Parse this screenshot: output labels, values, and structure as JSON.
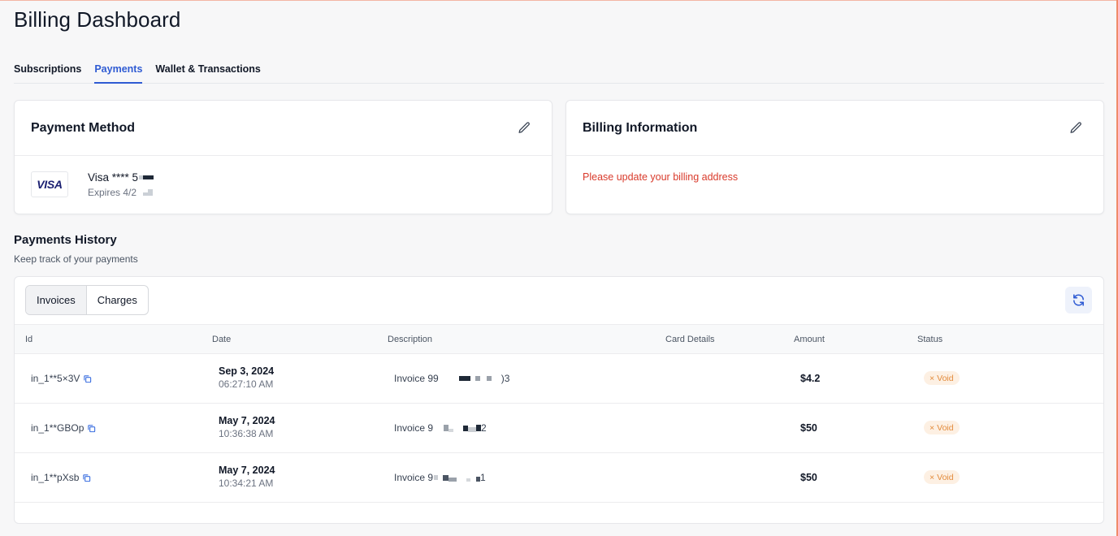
{
  "page": {
    "title": "Billing Dashboard"
  },
  "tabs": [
    {
      "label": "Subscriptions",
      "active": false
    },
    {
      "label": "Payments",
      "active": true
    },
    {
      "label": "Wallet & Transactions",
      "active": false
    }
  ],
  "payment_method": {
    "title": "Payment Method",
    "card_brand": "VISA",
    "card_label": "Visa **** 5",
    "expires": "Expires 4/2",
    "edit_icon": "pencil-icon"
  },
  "billing_info": {
    "title": "Billing Information",
    "warning": "Please update your billing address",
    "edit_icon": "pencil-icon"
  },
  "history": {
    "title": "Payments History",
    "subtitle": "Keep track of your payments",
    "segments": [
      {
        "label": "Invoices",
        "active": true
      },
      {
        "label": "Charges",
        "active": false
      }
    ],
    "refresh_icon": "refresh-icon",
    "columns": [
      "Id",
      "Date",
      "Description",
      "Card Details",
      "Amount",
      "Status"
    ],
    "rows": [
      {
        "id": "in_1**5×3V",
        "date": "Sep 3, 2024",
        "time": "06:27:10 AM",
        "desc_prefix": "Invoice 99",
        "desc_suffix": ")3",
        "amount": "$4.2",
        "status": "Void"
      },
      {
        "id": "in_1**GBOp",
        "date": "May 7, 2024",
        "time": "10:36:38 AM",
        "desc_prefix": "Invoice 9",
        "desc_suffix": "2",
        "amount": "$50",
        "status": "Void"
      },
      {
        "id": "in_1**pXsb",
        "date": "May 7, 2024",
        "time": "10:34:21 AM",
        "desc_prefix": "Invoice 9",
        "desc_suffix": "1",
        "amount": "$50",
        "status": "Void"
      }
    ]
  },
  "colors": {
    "accent": "#2f5bd3",
    "warning": "#d93a2b",
    "void_badge_bg": "#fdf0e3",
    "void_badge_text": "#e28a3a"
  }
}
